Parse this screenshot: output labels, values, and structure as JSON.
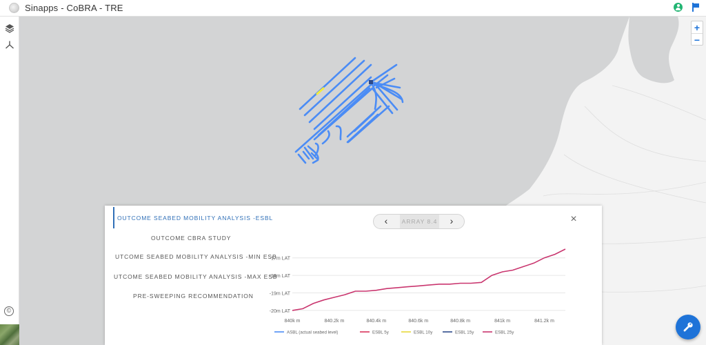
{
  "app": {
    "title": "Sinapps - CoBRA - TRE",
    "icons": [
      "app-logo-icon",
      "user-icon",
      "flag-icon",
      "layers-icon",
      "network-icon",
      "copyright-icon",
      "wrench-icon"
    ],
    "accent_color": "#1e73d8"
  },
  "map": {
    "zoom_in_label": "+",
    "zoom_out_label": "−",
    "copyright_symbol": "©",
    "cable_color": "#4b8cf5",
    "highlight_color": "#f2ec3b"
  },
  "panel": {
    "tabs": [
      {
        "label": "OUTCOME SEABED MOBILITY ANALYSIS -ESBL",
        "active": true
      },
      {
        "label": "OUTCOME CBRA STUDY",
        "active": false
      },
      {
        "label": "UTCOME SEABED MOBILITY ANALYSIS -MIN ESB",
        "active": false
      },
      {
        "label": "UTCOME SEABED MOBILITY ANALYSIS -MAX ESB",
        "active": false
      },
      {
        "label": "PRE-SWEEPING RECOMMENDATION",
        "active": false
      }
    ],
    "pager": {
      "prev": "‹",
      "label": "ARRAY 8.4",
      "next": "›"
    },
    "close": "×"
  },
  "chart_data": {
    "type": "line",
    "x_ticks": [
      "840k m",
      "840.2k m",
      "840.4k m",
      "840.6k m",
      "840.8k m",
      "841k m",
      "841.2k m"
    ],
    "x_tick_values": [
      840000,
      840200,
      840400,
      840600,
      840800,
      841000,
      841200
    ],
    "y_ticks": [
      "-17m LAT",
      "-18m LAT",
      "-19m LAT",
      "-20m LAT"
    ],
    "y_tick_values": [
      -17,
      -18,
      -19,
      -20
    ],
    "xlim": [
      840000,
      841300
    ],
    "ylim": [
      -20.2,
      -16.5
    ],
    "grid": true,
    "legend_position": "bottom",
    "series": [
      {
        "name": "ASBL (actual seabed level)",
        "color": "#4b8cf5",
        "x": [],
        "y": []
      },
      {
        "name": "ESBL 5y",
        "color": "#d8325a",
        "x": [],
        "y": []
      },
      {
        "name": "ESBL 10y",
        "color": "#e8d83a",
        "x": [],
        "y": []
      },
      {
        "name": "ESBL 15y",
        "color": "#2d4a8a",
        "x": [],
        "y": []
      },
      {
        "name": "ESBL 25y",
        "color": "#c9356e",
        "x": [
          840000,
          840050,
          840100,
          840150,
          840200,
          840250,
          840300,
          840350,
          840400,
          840450,
          840500,
          840550,
          840600,
          840650,
          840700,
          840750,
          840800,
          840850,
          840900,
          840950,
          841000,
          841050,
          841100,
          841150,
          841200,
          841250,
          841300
        ],
        "y": [
          -20.0,
          -19.9,
          -19.6,
          -19.4,
          -19.25,
          -19.1,
          -18.9,
          -18.9,
          -18.85,
          -18.75,
          -18.7,
          -18.65,
          -18.6,
          -18.55,
          -18.5,
          -18.5,
          -18.45,
          -18.45,
          -18.4,
          -18.0,
          -17.8,
          -17.7,
          -17.5,
          -17.3,
          -17.0,
          -16.8,
          -16.5
        ]
      }
    ]
  }
}
